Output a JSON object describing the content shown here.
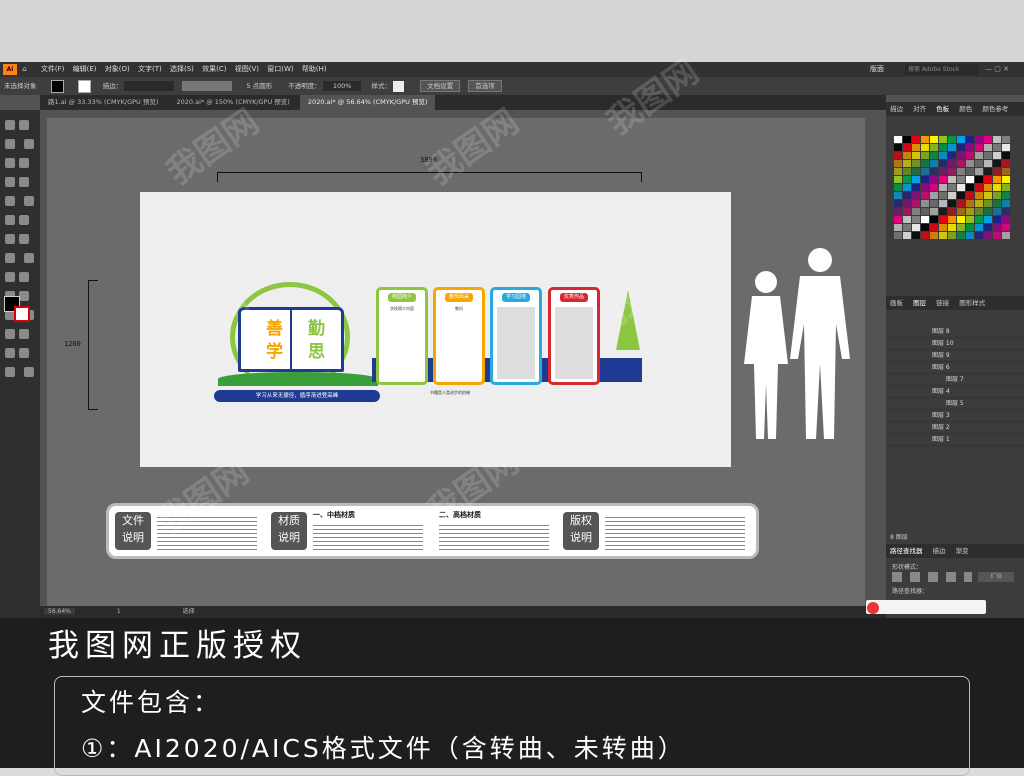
{
  "menubar": {
    "items": [
      "文件(F)",
      "编辑(E)",
      "对象(O)",
      "文字(T)",
      "选择(S)",
      "效果(C)",
      "视图(V)",
      "窗口(W)",
      "帮助(H)"
    ],
    "workspace": "版面",
    "search_placeholder": "搜索 Adobe Stock"
  },
  "controlbar": {
    "selection_label": "未选择对象",
    "stroke_label": "描边：",
    "brush_label": "5 点圆形",
    "opacity_label": "不透明度：",
    "opacity_value": "100%",
    "style_label": "样式：",
    "doc_setup": "文档设置",
    "prefs": "首选项"
  },
  "tabs": [
    {
      "label": "路1.ai @ 33.33% (CMYK/GPU 预览)",
      "active": false
    },
    {
      "label": "2020.ai* @ 150% (CMYK/GPU 预览)",
      "active": false
    },
    {
      "label": "2020.ai* @ 56.64% (CMYK/GPU 预览)",
      "active": true
    }
  ],
  "status": {
    "zoom": "56.64%",
    "page": "1",
    "mode": "选择"
  },
  "dimensions": {
    "width": "3890",
    "height": "1200"
  },
  "wall": {
    "char1": "善",
    "char2": "勤",
    "char3": "学",
    "char4": "思",
    "slogan": "学习从来无捷径，循序渐进登高峰",
    "panels": [
      {
        "title": "校园简介",
        "color": "#8dc63f",
        "subtitle": "学校简介内容"
      },
      {
        "title": "教师风采",
        "color": "#f7a600",
        "subtitle": "教风"
      },
      {
        "title": "学习园地",
        "color": "#29a9e0",
        "subtitle": ""
      },
      {
        "title": "优秀作品",
        "color": "#d7282f",
        "subtitle": ""
      }
    ],
    "tagline": "书籍是人类进步的阶梯"
  },
  "notes": {
    "file_desc": [
      "文件",
      "说明"
    ],
    "material_desc": [
      "材质",
      "说明"
    ],
    "copyright_desc": [
      "版权",
      "说明"
    ],
    "mid_grade": "一、中档材质",
    "high_grade": "二、高档材质"
  },
  "right_panel": {
    "tabs_top": [
      "描边",
      "对齐",
      "色板",
      "颜色",
      "颜色参考"
    ],
    "tabs_layers": [
      "画板",
      "图层",
      "链接",
      "图形样式"
    ],
    "layers": [
      "图层 8",
      "图层 10",
      "图层 9",
      "图层 6",
      "图层 7",
      "图层 4",
      "图层 5",
      "图层 3",
      "图层 2",
      "图层 1"
    ],
    "layers_count": "8 图层",
    "pathfinder_tabs": [
      "路径查找器",
      "描边",
      "渐变"
    ],
    "shape_mode": "形状模式：",
    "pathfinder": "路径查找器：",
    "expand": "扩展"
  },
  "watermark": "我图网",
  "footer": {
    "title": "我图网正版授权",
    "contains": "文件包含：",
    "line1": "①：AI2020/AICS格式文件（含转曲、未转曲）"
  },
  "colors": {
    "green": "#8dc63f",
    "orange": "#f7a600",
    "blue": "#29a9e0",
    "red": "#d7282f",
    "navy": "#1f3a93"
  }
}
